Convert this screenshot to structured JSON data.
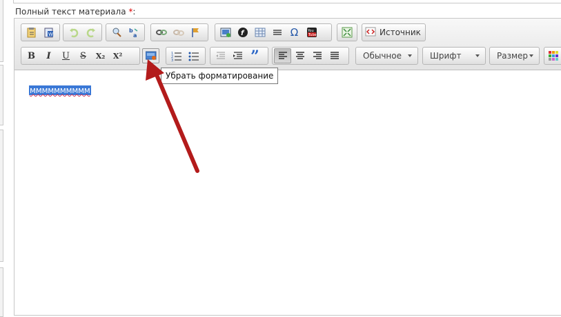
{
  "form": {
    "field_label": "Полный текст материала",
    "required_mark": "*",
    "label_suffix": ":"
  },
  "toolbar": {
    "row1": {
      "group_paste": [
        "paste-text-icon",
        "paste-from-word-icon"
      ],
      "group_undo": [
        "undo-icon",
        "redo-icon"
      ],
      "group_find": [
        "find-icon",
        "replace-icon"
      ],
      "group_links": [
        "link-icon",
        "unlink-icon",
        "anchor-icon"
      ],
      "group_insert": [
        "image-icon",
        "flash-icon",
        "table-icon",
        "horizontal-line-icon",
        "special-char-icon",
        "youtube-icon"
      ],
      "group_view": [
        "maximize-icon"
      ],
      "source_label": "Источник"
    },
    "row2": {
      "group_basic": [
        {
          "name": "bold",
          "glyph": "B"
        },
        {
          "name": "italic",
          "glyph": "I"
        },
        {
          "name": "underline",
          "glyph": "U"
        },
        {
          "name": "strike",
          "glyph": "S"
        },
        {
          "name": "subscript",
          "glyph": "X₂"
        },
        {
          "name": "superscript",
          "glyph": "X²"
        }
      ],
      "remove_format_icon": "remove-format-icon",
      "group_lists": [
        "numbered-list-icon",
        "bulleted-list-icon"
      ],
      "group_indent": [
        "outdent-icon",
        "indent-icon",
        "blockquote-icon"
      ],
      "group_align": [
        "align-left-icon",
        "align-center-icon",
        "align-right-icon",
        "justify-icon"
      ],
      "active_align": "align-left",
      "format_combo": "Обычное",
      "font_combo": "Шрифт",
      "size_combo": "Размер"
    }
  },
  "tooltip": {
    "text": "Убрать форматирование"
  },
  "content": {
    "text": "мммммммммм"
  },
  "colors": {
    "selection": "#3a78d6",
    "annotation_arrow": "#b31b1b",
    "required": "#dd0000"
  }
}
